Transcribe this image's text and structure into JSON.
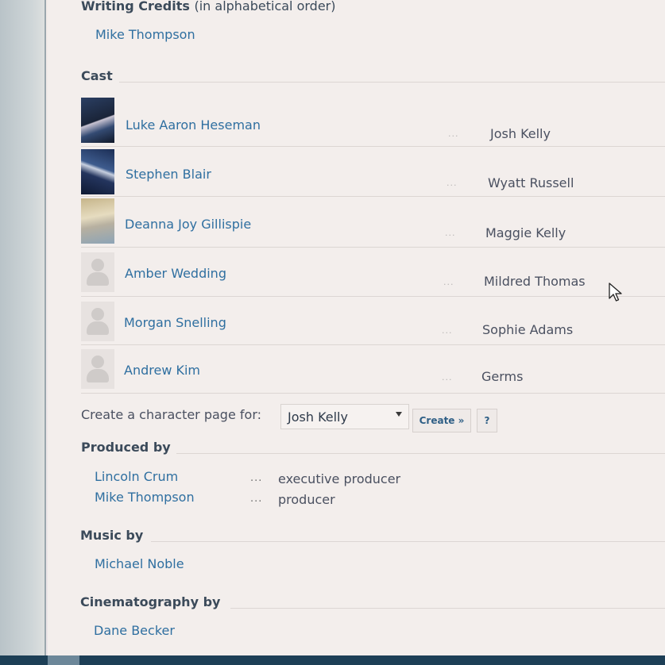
{
  "writing_credits": {
    "heading": "Writing Credits",
    "heading_note": "(in alphabetical order)",
    "writers": [
      "Mike Thompson"
    ]
  },
  "cast": {
    "heading": "Cast",
    "separator": "...",
    "members": [
      {
        "actor": "Luke Aaron Heseman",
        "character": "Josh Kelly",
        "photo": "photo"
      },
      {
        "actor": "Stephen Blair",
        "character": "Wyatt Russell",
        "photo": "photo"
      },
      {
        "actor": "Deanna Joy Gillispie",
        "character": "Maggie Kelly",
        "photo": "photo"
      },
      {
        "actor": "Amber Wedding",
        "character": "Mildred Thomas",
        "photo": "placeholder-person-icon"
      },
      {
        "actor": "Morgan Snelling",
        "character": "Sophie Adams",
        "photo": "placeholder-person-icon"
      },
      {
        "actor": "Andrew Kim",
        "character": "Germs",
        "photo": "placeholder-person-icon"
      }
    ]
  },
  "character_page": {
    "label": "Create a character page for:",
    "selected": "Josh Kelly",
    "create_button": "Create »",
    "help_button": "?"
  },
  "produced_by": {
    "heading": "Produced by",
    "separator": "...",
    "producers": [
      {
        "name": "Lincoln Crum",
        "role": "executive producer"
      },
      {
        "name": "Mike Thompson",
        "role": "producer"
      }
    ]
  },
  "music_by": {
    "heading": "Music by",
    "people": [
      "Michael Noble"
    ]
  },
  "cinematography_by": {
    "heading": "Cinematography by",
    "people": [
      "Dane Becker"
    ]
  }
}
